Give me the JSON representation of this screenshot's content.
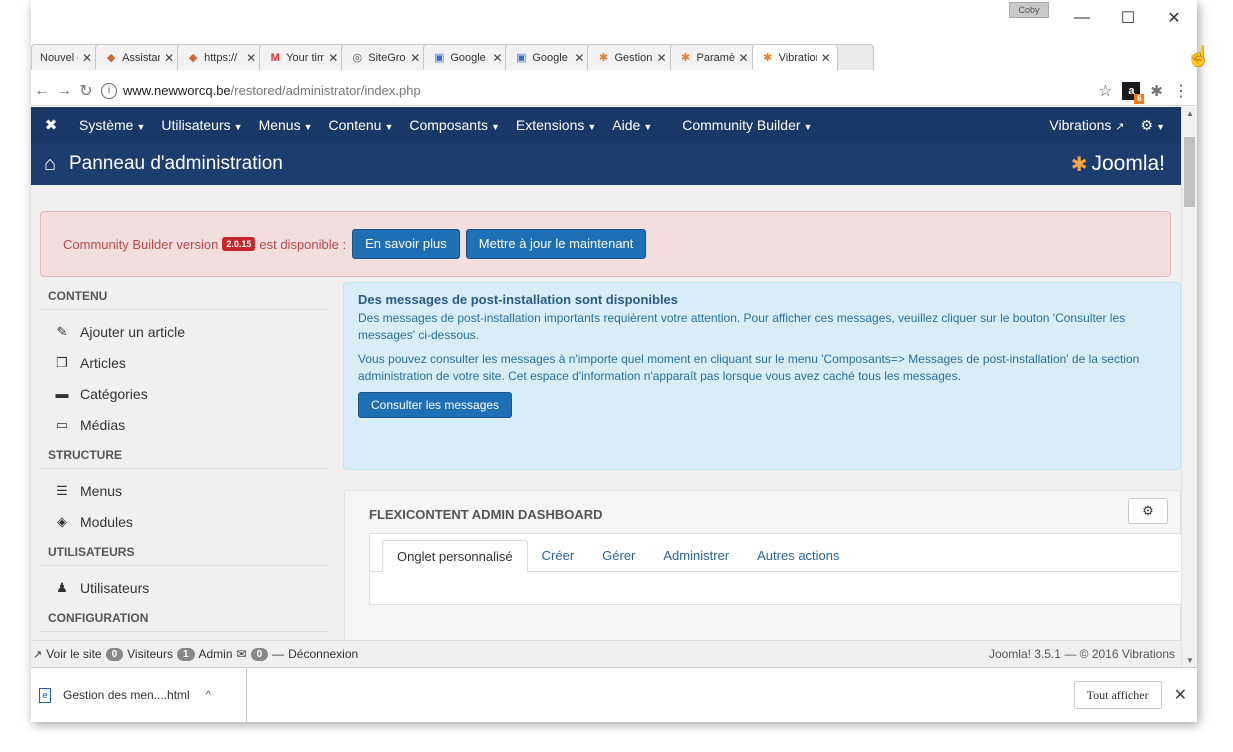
{
  "browser": {
    "tabs": [
      {
        "label": "Nouvel onglet",
        "icon": "blank-page-icon"
      },
      {
        "label": "Assistant",
        "icon": "puzzle-icon"
      },
      {
        "label": "https://",
        "icon": "puzzle-icon"
      },
      {
        "label": "Your timeline",
        "icon": "gmail-icon"
      },
      {
        "label": "SiteGround",
        "icon": "siteground-icon"
      },
      {
        "label": "Google",
        "icon": "google-search-icon"
      },
      {
        "label": "Google",
        "icon": "google-search-icon"
      },
      {
        "label": "Gestion",
        "icon": "joomla-icon"
      },
      {
        "label": "Paramètres",
        "icon": "joomla-icon"
      },
      {
        "label": "Vibrations",
        "icon": "joomla-icon"
      }
    ],
    "url_host": "www.newworcq.be",
    "url_path": "/restored/administrator/index.php"
  },
  "nav": {
    "items": [
      "Système",
      "Utilisateurs",
      "Menus",
      "Contenu",
      "Composants",
      "Extensions",
      "Aide",
      "Community Builder"
    ],
    "site_link": "Vibrations"
  },
  "header": {
    "title": "Panneau d'administration",
    "logo_text": "Joomla!"
  },
  "alert": {
    "text_before": "Community Builder version",
    "version": "2.0.15",
    "text_after": "est disponible :",
    "btn_more": "En savoir plus",
    "btn_update": "Mettre à jour le maintenant"
  },
  "sidebar": {
    "sections": [
      {
        "title": "CONTENU",
        "items": [
          {
            "label": "Ajouter un article",
            "icon": "pencil-icon"
          },
          {
            "label": "Articles",
            "icon": "copy-icon"
          },
          {
            "label": "Catégories",
            "icon": "folder-icon"
          },
          {
            "label": "Médias",
            "icon": "image-icon"
          }
        ]
      },
      {
        "title": "STRUCTURE",
        "items": [
          {
            "label": "Menus",
            "icon": "list-icon"
          },
          {
            "label": "Modules",
            "icon": "cube-icon"
          }
        ]
      },
      {
        "title": "UTILISATEURS",
        "items": [
          {
            "label": "Utilisateurs",
            "icon": "users-icon"
          }
        ]
      },
      {
        "title": "CONFIGURATION",
        "items": []
      }
    ]
  },
  "postinstall": {
    "title": "Des messages de post-installation sont disponibles",
    "para1": "Des messages de post-installation importants requièrent votre attention. Pour afficher ces messages, veuillez cliquer sur le bouton 'Consulter les messages' ci-dessous.",
    "para2": "Vous pouvez consulter les messages à n'importe quel moment en cliquant sur le menu 'Composants=> Messages de post-installation' de la section administration de votre site. Cet espace d'information n'apparaît pas lorsque vous avez caché tous les messages.",
    "button": "Consulter les messages"
  },
  "flexi": {
    "title": "FLEXICONTENT ADMIN DASHBOARD",
    "tabs": [
      "Onglet personnalisé",
      "Créer",
      "Gérer",
      "Administrer",
      "Autres actions"
    ]
  },
  "status": {
    "view_site": "Voir le site",
    "visitors_count": "0",
    "visitors_label": "Visiteurs",
    "admin_count": "1",
    "admin_label": "Admin",
    "messages_count": "0",
    "logout": "Déconnexion",
    "version": "Joomla! 3.5.1 — © 2016 Vibrations"
  },
  "downloads": {
    "file": "Gestion des men....html",
    "show_all": "Tout afficher"
  },
  "colors": {
    "nav_bg": "#1a3867",
    "alert_bg": "#f2dede",
    "info_bg": "#d9edf7",
    "button_blue": "#1f6fb5"
  }
}
